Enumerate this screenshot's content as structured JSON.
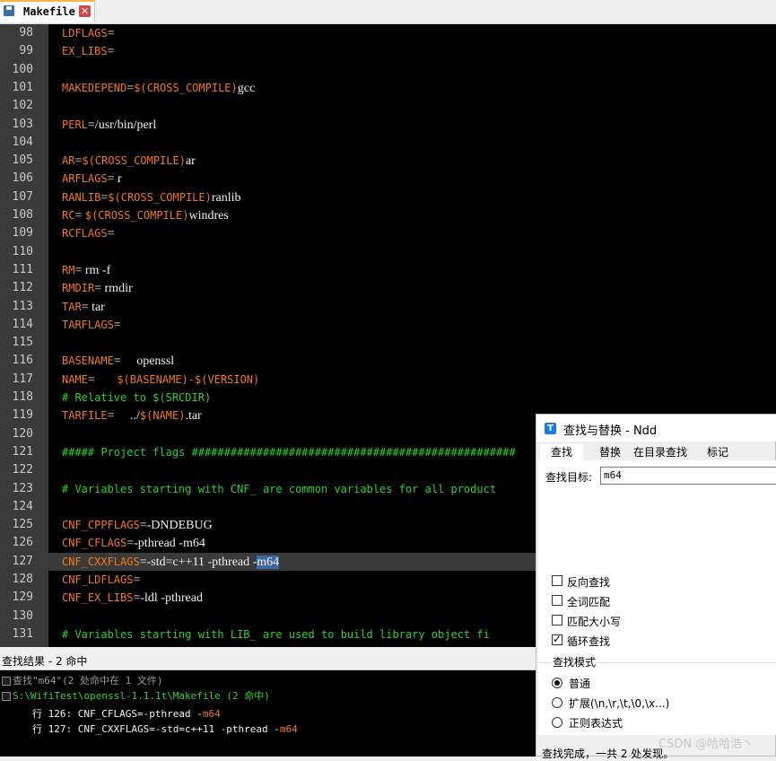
{
  "tab": {
    "filename": "Makefile",
    "close_label": "✕"
  },
  "editor": {
    "lines": [
      {
        "n": "98",
        "seg": [
          [
            "k",
            "LDFLAGS"
          ],
          [
            "v",
            "="
          ]
        ]
      },
      {
        "n": "99",
        "seg": [
          [
            "k",
            "EX_LIBS"
          ],
          [
            "v",
            "="
          ]
        ]
      },
      {
        "n": "100",
        "seg": []
      },
      {
        "n": "101",
        "seg": [
          [
            "k",
            "MAKEDEPEND"
          ],
          [
            "v",
            "="
          ],
          [
            "k",
            "$(CROSS_COMPILE)"
          ],
          [
            "v",
            "gcc"
          ]
        ]
      },
      {
        "n": "102",
        "seg": []
      },
      {
        "n": "103",
        "seg": [
          [
            "k",
            "PERL"
          ],
          [
            "v",
            "=/usr/bin/perl"
          ]
        ]
      },
      {
        "n": "104",
        "seg": []
      },
      {
        "n": "105",
        "seg": [
          [
            "k",
            "AR"
          ],
          [
            "v",
            "="
          ],
          [
            "k",
            "$(CROSS_COMPILE)"
          ],
          [
            "v",
            "ar"
          ]
        ]
      },
      {
        "n": "106",
        "seg": [
          [
            "k",
            "ARFLAGS"
          ],
          [
            "v",
            "= r"
          ]
        ]
      },
      {
        "n": "107",
        "seg": [
          [
            "k",
            "RANLIB"
          ],
          [
            "v",
            "="
          ],
          [
            "k",
            "$(CROSS_COMPILE)"
          ],
          [
            "v",
            "ranlib"
          ]
        ]
      },
      {
        "n": "108",
        "seg": [
          [
            "k",
            "RC"
          ],
          [
            "v",
            "= "
          ],
          [
            "k",
            "$(CROSS_COMPILE)"
          ],
          [
            "v",
            "windres"
          ]
        ]
      },
      {
        "n": "109",
        "seg": [
          [
            "k",
            "RCFLAGS"
          ],
          [
            "v",
            "="
          ]
        ]
      },
      {
        "n": "110",
        "seg": []
      },
      {
        "n": "111",
        "seg": [
          [
            "k",
            "RM"
          ],
          [
            "v",
            "= rm -f"
          ]
        ]
      },
      {
        "n": "112",
        "seg": [
          [
            "k",
            "RMDIR"
          ],
          [
            "v",
            "= rmdir"
          ]
        ]
      },
      {
        "n": "113",
        "seg": [
          [
            "k",
            "TAR"
          ],
          [
            "v",
            "= tar"
          ]
        ]
      },
      {
        "n": "114",
        "seg": [
          [
            "k",
            "TARFLAGS"
          ],
          [
            "v",
            "="
          ]
        ]
      },
      {
        "n": "115",
        "seg": []
      },
      {
        "n": "116",
        "seg": [
          [
            "k",
            "BASENAME"
          ],
          [
            "v",
            "=     openssl"
          ]
        ]
      },
      {
        "n": "117",
        "seg": [
          [
            "k",
            "NAME"
          ],
          [
            "v",
            "=       "
          ],
          [
            "k",
            "$(BASENAME)-$(VERSION)"
          ]
        ]
      },
      {
        "n": "118",
        "seg": [
          [
            "c",
            "# Relative to $(SRCDIR)"
          ]
        ]
      },
      {
        "n": "119",
        "seg": [
          [
            "k",
            "TARFILE"
          ],
          [
            "v",
            "=     ../"
          ],
          [
            "k",
            "$(NAME)"
          ],
          [
            "v",
            ".tar"
          ]
        ]
      },
      {
        "n": "120",
        "seg": []
      },
      {
        "n": "121",
        "seg": [
          [
            "c",
            "##### Project flags ##################################################"
          ]
        ]
      },
      {
        "n": "122",
        "seg": []
      },
      {
        "n": "123",
        "seg": [
          [
            "c",
            "# Variables starting with CNF_ are common variables for all product"
          ]
        ]
      },
      {
        "n": "124",
        "seg": []
      },
      {
        "n": "125",
        "seg": [
          [
            "k",
            "CNF_CPPFLAGS"
          ],
          [
            "v",
            "=-DNDEBUG"
          ]
        ]
      },
      {
        "n": "126",
        "seg": [
          [
            "k",
            "CNF_CFLAGS"
          ],
          [
            "v",
            "=-pthread -m64"
          ]
        ]
      },
      {
        "n": "127",
        "seg": [
          [
            "k",
            "CNF_CXXFLAGS"
          ],
          [
            "v",
            "=-std=c++11 -pthread -"
          ],
          [
            "s",
            "m64"
          ]
        ],
        "current": true
      },
      {
        "n": "128",
        "seg": [
          [
            "k",
            "CNF_LDFLAGS"
          ],
          [
            "v",
            "="
          ]
        ]
      },
      {
        "n": "129",
        "seg": [
          [
            "k",
            "CNF_EX_LIBS"
          ],
          [
            "v",
            "=-ldl -pthread"
          ]
        ]
      },
      {
        "n": "130",
        "seg": []
      },
      {
        "n": "131",
        "seg": [
          [
            "c",
            "# Variables starting with LIB_ are used to build library object fi"
          ]
        ]
      }
    ]
  },
  "results": {
    "title": "查找结果 - 2 命中",
    "summary": "查找\"m64\"(2 处命中在 1 文件)",
    "file": "S:\\WifiTest\\openssl-1.1.1t\\Makefile (2 命中)",
    "hits": [
      {
        "prefix": "行 126:",
        "text": " CNF_CFLAGS=-pthread -",
        "match": "m64"
      },
      {
        "prefix": "行 127:",
        "text": " CNF_CXXFLAGS=-std=c++11 -pthread -",
        "match": "m64"
      }
    ]
  },
  "dialog": {
    "title": "查找与替换 - Ndd",
    "tabs": [
      "查找",
      "替换",
      "在目录查找",
      "标记"
    ],
    "find_label": "查找目标:",
    "find_value": "m64",
    "options": [
      {
        "label": "反向查找",
        "checked": false
      },
      {
        "label": "全词匹配",
        "checked": false
      },
      {
        "label": "匹配大小写",
        "checked": false
      },
      {
        "label": "循环查找",
        "checked": true
      }
    ],
    "mode_label": "查找模式",
    "modes": [
      {
        "label": "普通",
        "selected": true
      },
      {
        "label": "扩展(\\n,\\r,\\t,\\0,\\x...)",
        "selected": false
      },
      {
        "label": "正则表达式",
        "selected": false
      }
    ],
    "status": "查找完成，一共 2 处发现。"
  },
  "watermark": "CSDN @哈哈浩丶"
}
